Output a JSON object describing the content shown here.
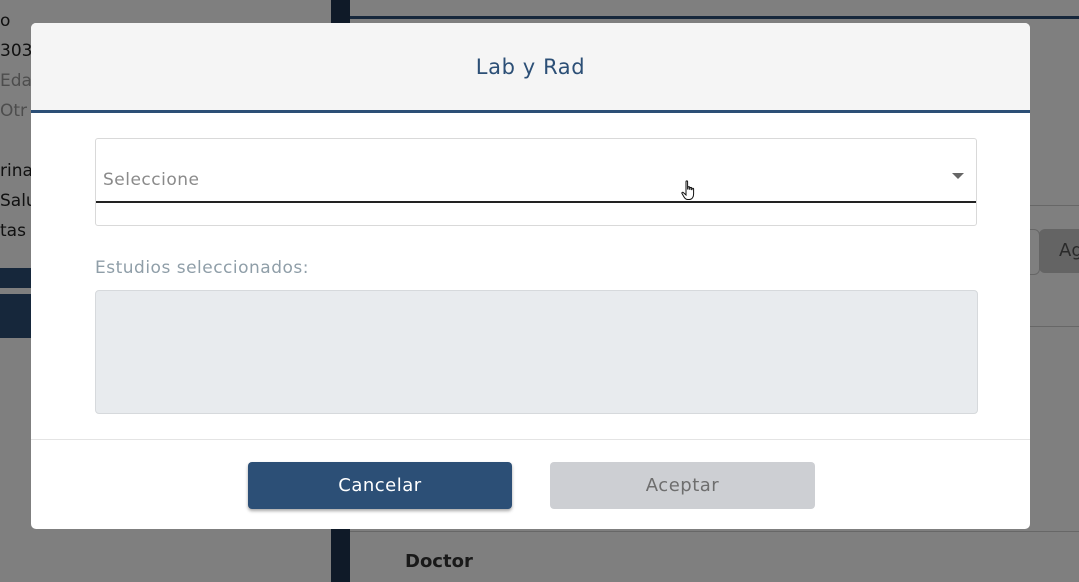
{
  "background": {
    "left_text_lines": [
      {
        "text": "o",
        "muted": false
      },
      {
        "text": "303",
        "muted": false
      },
      {
        "text": "Eda",
        "muted": true
      },
      {
        "text": "Otr",
        "muted": true
      },
      {
        "text": "rina",
        "muted": false
      },
      {
        "text": "Salu",
        "muted": false
      },
      {
        "text": "tas",
        "muted": false
      }
    ],
    "right_button_label": "Ag",
    "doctor_label": "Doctor"
  },
  "modal": {
    "title": "Lab y Rad",
    "select": {
      "value": "Seleccione",
      "icon": "chevron-down-icon"
    },
    "studies_label": "Estudios seleccionados:",
    "cancel_label": "Cancelar",
    "accept_label": "Aceptar"
  },
  "colors": {
    "primary": "#2c4f76",
    "disabled_button": "#cdcfd3",
    "studies_area": "#e8ebee"
  }
}
